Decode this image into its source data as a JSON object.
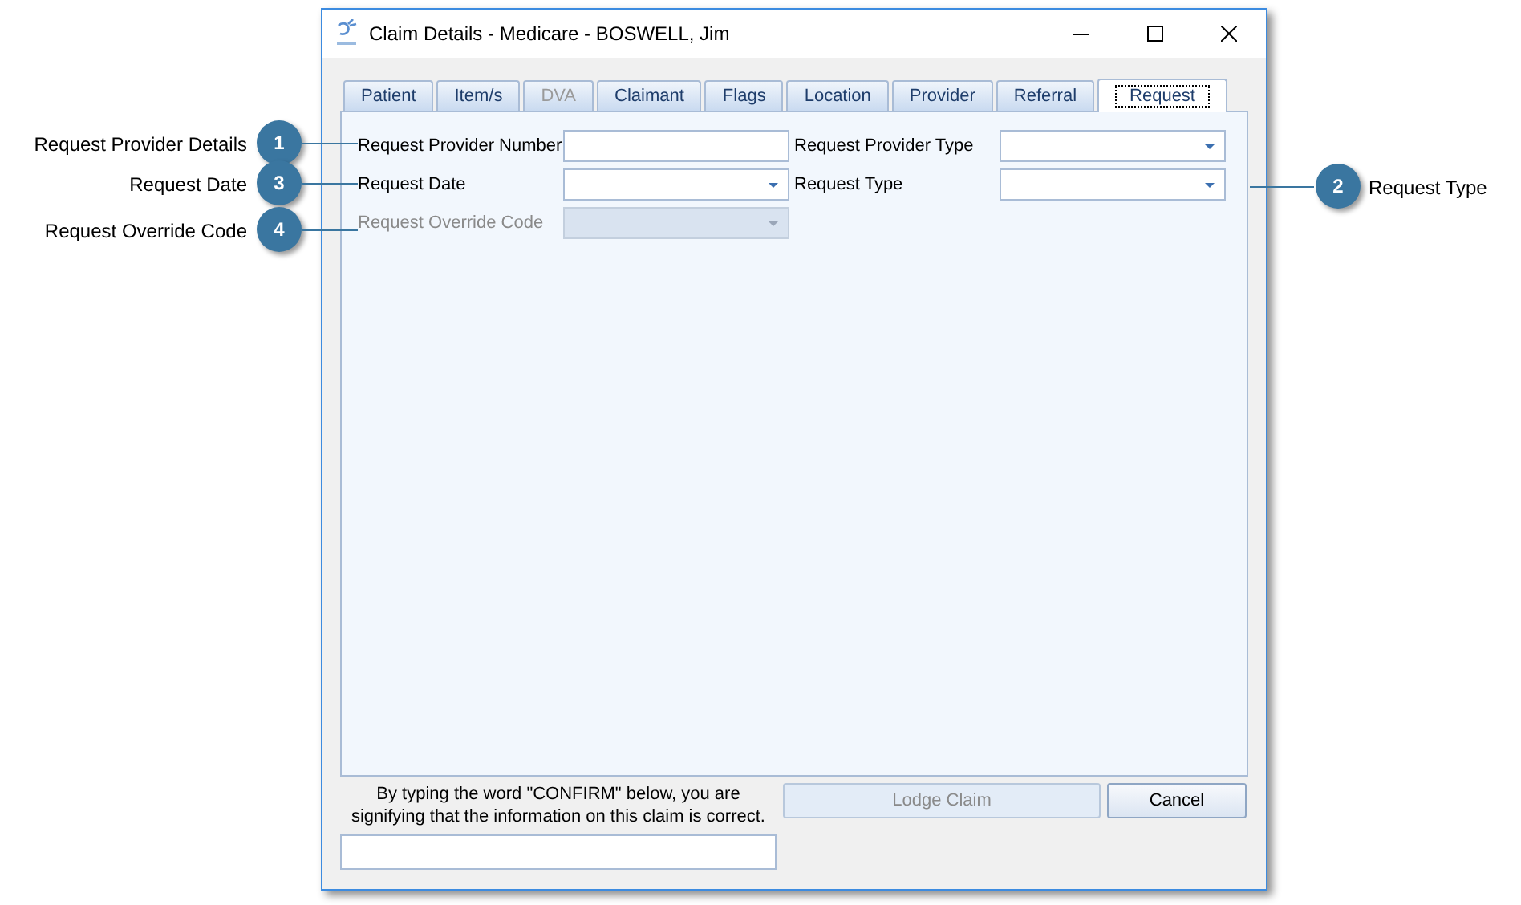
{
  "window": {
    "title": "Claim Details - Medicare - BOSWELL, Jim"
  },
  "tabs": [
    {
      "label": "Patient",
      "selected": false,
      "disabled": false
    },
    {
      "label": "Item/s",
      "selected": false,
      "disabled": false
    },
    {
      "label": "DVA",
      "selected": false,
      "disabled": true
    },
    {
      "label": "Claimant",
      "selected": false,
      "disabled": false
    },
    {
      "label": "Flags",
      "selected": false,
      "disabled": false
    },
    {
      "label": "Location",
      "selected": false,
      "disabled": false
    },
    {
      "label": "Provider",
      "selected": false,
      "disabled": false
    },
    {
      "label": "Referral",
      "selected": false,
      "disabled": false
    },
    {
      "label": "Request",
      "selected": true,
      "disabled": false
    }
  ],
  "fields": [
    {
      "label": "Request Provider Number",
      "kind": "text",
      "disabled": false
    },
    {
      "label": "Request Provider Type",
      "kind": "combo",
      "disabled": false
    },
    {
      "label": "Request Date",
      "kind": "combo",
      "disabled": false
    },
    {
      "label": "Request Type",
      "kind": "combo",
      "disabled": false
    },
    {
      "label": "Request Override Code",
      "kind": "combo",
      "disabled": true
    }
  ],
  "confirm": {
    "text": "By typing the word \"CONFIRM\" below, you are signifying that the information on this claim is correct."
  },
  "buttons": [
    {
      "label": "Lodge Claim",
      "disabled": true
    },
    {
      "label": "Cancel",
      "disabled": false
    }
  ],
  "left_callouts": [
    {
      "number": "1",
      "label": "Request Provider Details"
    },
    {
      "number": "3",
      "label": "Request Date"
    },
    {
      "number": "4",
      "label": "Request Override Code"
    }
  ],
  "right_callouts": [
    {
      "number": "2",
      "label": "Request Type"
    }
  ]
}
